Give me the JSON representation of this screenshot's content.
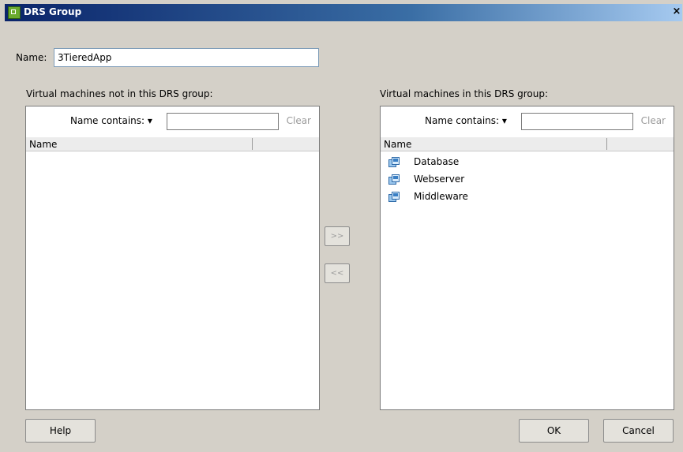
{
  "window": {
    "title": "DRS Group",
    "close_glyph": "×"
  },
  "name_field": {
    "label": "Name:",
    "value": "3TieredApp"
  },
  "left_panel": {
    "heading": "Virtual machines not in this DRS group:",
    "filter_label": "Name contains: ▾",
    "filter_value": "",
    "clear_label": "Clear",
    "column_header": "Name",
    "items": []
  },
  "right_panel": {
    "heading": "Virtual machines in this DRS group:",
    "filter_label": "Name contains: ▾",
    "filter_value": "",
    "clear_label": "Clear",
    "column_header": "Name",
    "items": [
      {
        "label": "Database",
        "icon": "vm-icon"
      },
      {
        "label": "Webserver",
        "icon": "vm-icon"
      },
      {
        "label": "Middleware",
        "icon": "vm-icon"
      }
    ]
  },
  "move_buttons": {
    "add_label": ">>",
    "remove_label": "<<"
  },
  "footer": {
    "help_label": "Help",
    "ok_label": "OK",
    "cancel_label": "Cancel"
  },
  "colors": {
    "dialog_bg": "#d4d0c8",
    "title_gradient_start": "#0a246a",
    "vm_icon": "#3a7fc4"
  }
}
